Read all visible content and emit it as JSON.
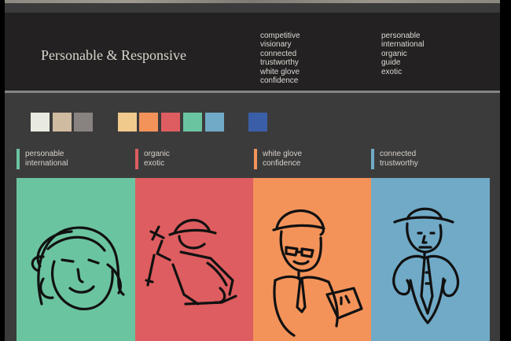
{
  "header": {
    "title": "Personable & Responsive",
    "words_col1": [
      "competitive",
      "visionary",
      "connected",
      "trustworthy",
      "white glove",
      "confidence"
    ],
    "words_col2": [
      "personable",
      "international",
      "organic",
      "guide",
      "exotic"
    ]
  },
  "palette": {
    "neutrals": [
      "#e9eadf",
      "#cfbba0",
      "#888381"
    ],
    "accents": [
      "#f0c98d",
      "#f3935a",
      "#de5d60",
      "#6bc4a0",
      "#70aac7"
    ],
    "feature": "#3b5ea8"
  },
  "pairs": [
    {
      "line1": "personable",
      "line2": "international",
      "color": "#6bc4a0"
    },
    {
      "line1": "organic",
      "line2": "exotic",
      "color": "#de5d60"
    },
    {
      "line1": "white glove",
      "line2": "confidence",
      "color": "#f3935a"
    },
    {
      "line1": "connected",
      "line2": "trustworthy",
      "color": "#70aac7"
    }
  ],
  "panels": [
    {
      "color": "#6bc4a0",
      "icon": "woman-face-sketch-icon"
    },
    {
      "color": "#de5d60",
      "icon": "explorer-sketch-icon"
    },
    {
      "color": "#f3935a",
      "icon": "worker-sketch-icon"
    },
    {
      "color": "#70aac7",
      "icon": "gentleman-sketch-icon"
    }
  ]
}
